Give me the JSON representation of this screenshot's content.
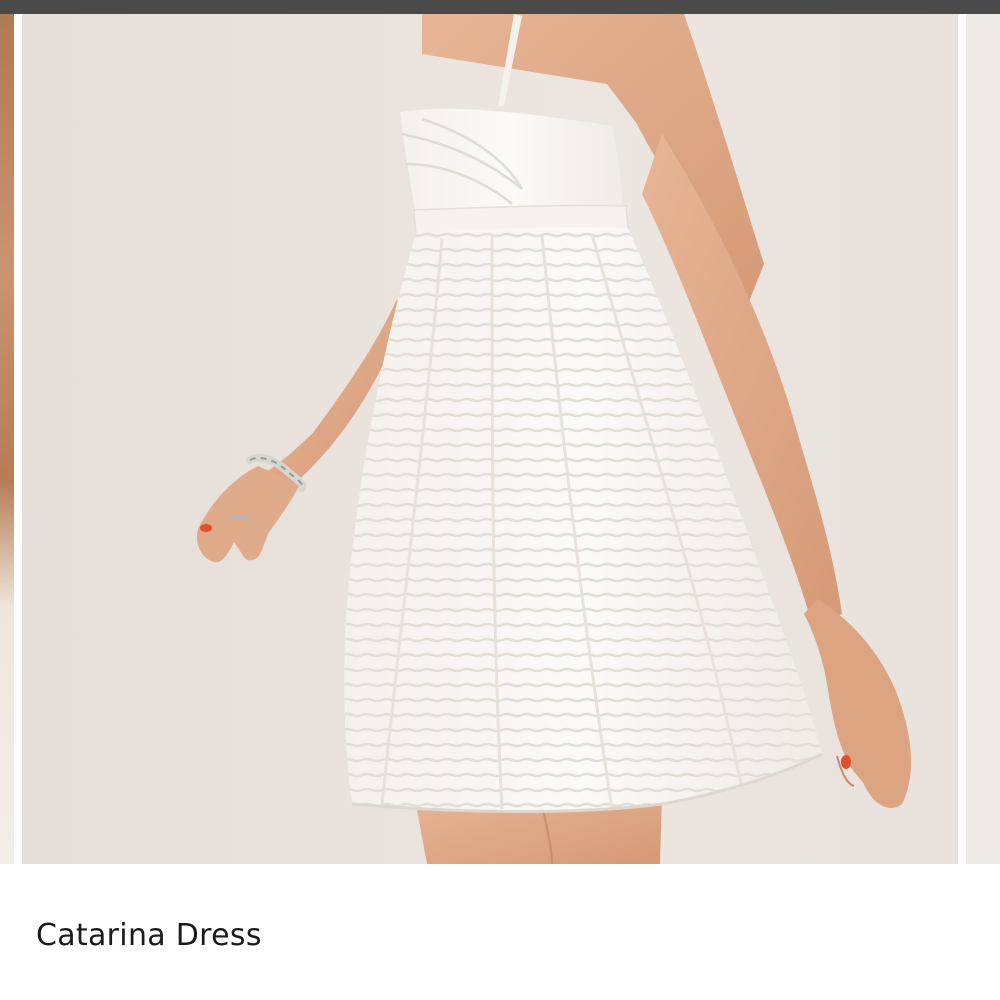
{
  "product": {
    "title": "Catarina Dress"
  },
  "gallery": {
    "main_image": "dress-photo"
  },
  "colors": {
    "top_bar": "#4a4a4a",
    "photo_background": "#ece4de",
    "dress": "#f7f5f1",
    "skin": "#dfa887",
    "nail_polish": "#e0502e",
    "title_text": "#1b1b1b"
  }
}
